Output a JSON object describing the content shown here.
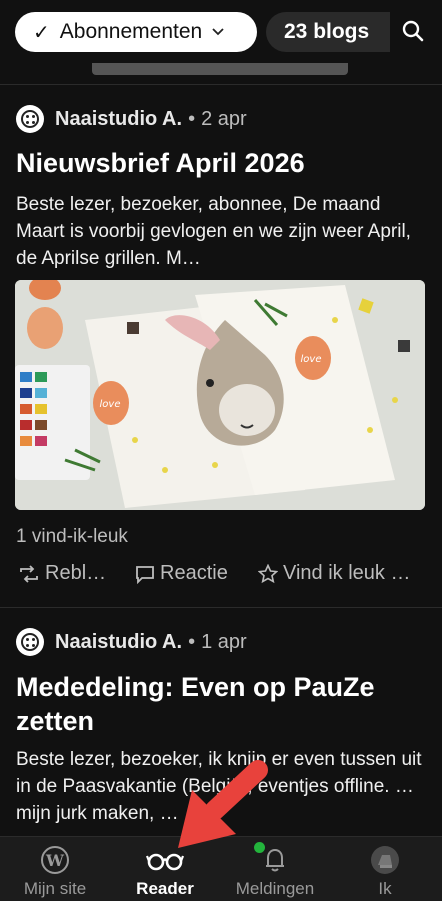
{
  "filter": {
    "label": "Abonnementen",
    "check": "✓",
    "chevron": "⌄"
  },
  "blogs": {
    "label": "23 blogs"
  },
  "posts": [
    {
      "author": "Naaistudio A.",
      "sep": "•",
      "date": "2 apr",
      "title": "Nieuwsbrief April 2026",
      "excerpt": "Beste lezer, bezoeker, abonnee, De maand Maart is voorbij gevlogen en we zijn weer April, de Aprilse grillen. M…",
      "likes": "1 vind-ik-leuk",
      "actions": {
        "reblog": "Rebl…",
        "comment": "Reactie",
        "like": "Vind ik leuk …"
      },
      "image_egg_text": "love"
    },
    {
      "author": "Naaistudio A.",
      "sep": "•",
      "date": "1 apr",
      "title": "Mededeling: Even op PauZe zetten",
      "excerpt": "Beste lezer, bezoeker, ik knijp er even tussen uit in de Paasvakantie (België), eventjes offline. … mijn jurk maken, …"
    }
  ],
  "nav": [
    {
      "label": "Mijn site",
      "icon": "wordpress-icon"
    },
    {
      "label": "Reader",
      "icon": "glasses-icon"
    },
    {
      "label": "Meldingen",
      "icon": "bell-icon"
    },
    {
      "label": "Ik",
      "icon": "avatar-icon"
    }
  ],
  "colors": {
    "background": "#111111",
    "nav_background": "#1c1c1c",
    "notification_dot": "#23b43c",
    "arrow": "#e8423c"
  }
}
